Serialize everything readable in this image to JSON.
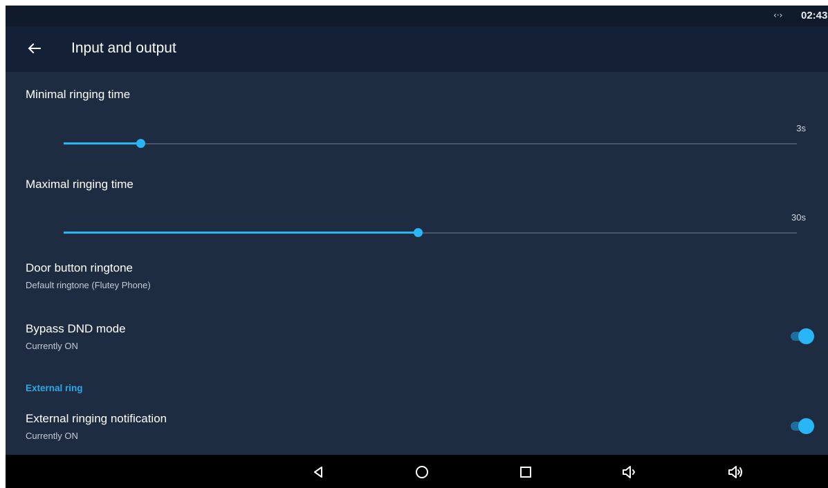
{
  "status_bar": {
    "sync_icon": "sync-arrows-icon",
    "sync_glyph": "‹·›",
    "time": "02:43"
  },
  "app_bar": {
    "back_icon": "arrow-left-icon",
    "title": "Input and output"
  },
  "colors": {
    "background": "#1e2c42",
    "app_bar": "#132035",
    "accent": "#29b6f6"
  },
  "settings": {
    "min_ringing": {
      "title": "Minimal ringing time",
      "value_label": "3s",
      "level": 0.105
    },
    "max_ringing": {
      "title": "Maximal ringing time",
      "value_label": "30s",
      "level": 0.483
    },
    "door_ringtone": {
      "title": "Door button ringtone",
      "summary": "Default ringtone (Flutey Phone)"
    },
    "bypass_dnd": {
      "title": "Bypass DND mode",
      "summary": "Currently ON",
      "checked": true
    },
    "external_category": "External ring",
    "external_notification": {
      "title": "External ringing notification",
      "summary": "Currently ON",
      "checked": true
    }
  },
  "nav_bar": {
    "buttons": [
      "back-triangle-icon",
      "home-circle-icon",
      "recents-square-icon",
      "volume-down-icon",
      "volume-up-icon"
    ]
  }
}
